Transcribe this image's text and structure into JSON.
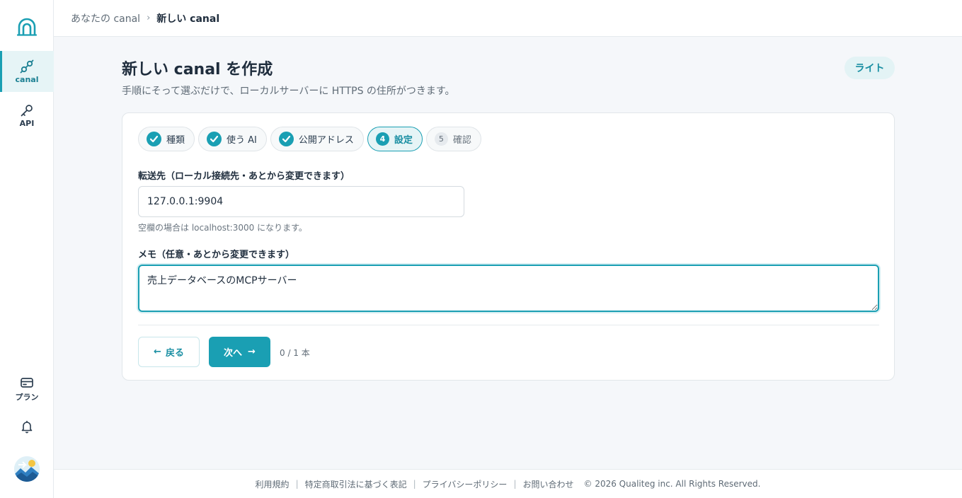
{
  "sidebar": {
    "logo_icon": "tunnel-arch-icon",
    "items": [
      {
        "label": "canal",
        "icon": "link-icon",
        "active": true
      },
      {
        "label": "API",
        "icon": "key-icon",
        "active": false
      }
    ],
    "bottom_items": [
      {
        "label": "プラン",
        "icon": "credit-card-icon"
      }
    ],
    "bell_icon": "bell-icon",
    "avatar_icon": "user-avatar"
  },
  "breadcrumb": {
    "parent": "あなたの canal",
    "separator": "›",
    "current": "新しい canal"
  },
  "header": {
    "title": "新しい canal を作成",
    "subtitle": "手順にそって選ぶだけで、ローカルサーバーに HTTPS の住所がつきます。",
    "plan_badge": "ライト"
  },
  "steps": [
    {
      "number": "1",
      "label": "種類",
      "state": "done"
    },
    {
      "number": "2",
      "label": "使う AI",
      "state": "done"
    },
    {
      "number": "3",
      "label": "公開アドレス",
      "state": "done"
    },
    {
      "number": "4",
      "label": "設定",
      "state": "active"
    },
    {
      "number": "5",
      "label": "確認",
      "state": "todo"
    }
  ],
  "form": {
    "target_label": "転送先（ローカル接続先・あとから変更できます）",
    "target_value": "127.0.0.1:9904",
    "target_help": "空欄の場合は localhost:3000 になります。",
    "memo_label": "メモ（任意・あとから変更できます）",
    "memo_value": "売上データベースのMCPサーバー"
  },
  "actions": {
    "back_label": "戻る",
    "next_label": "次へ",
    "count_text": "0 / 1 本"
  },
  "footer": {
    "links": [
      "利用規約",
      "特定商取引法に基づく表記",
      "プライバシーポリシー",
      "お問い合わせ"
    ],
    "copyright": "© 2026 Qualiteg inc. All Rights Reserved."
  },
  "colors": {
    "accent": "#1a9fb3",
    "accent_light": "#e6f4f6",
    "text": "#1f2d3d",
    "muted": "#5f6b76"
  }
}
